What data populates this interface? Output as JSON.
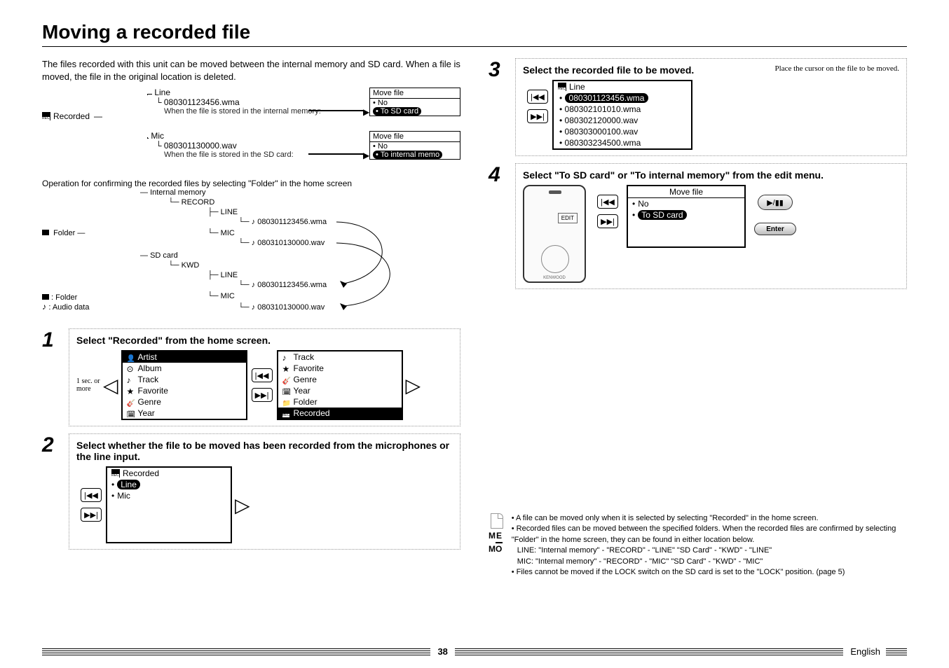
{
  "title": "Moving a recorded file",
  "intro": "The files recorded with this unit can be moved between the internal memory and SD card. When a file is moved, the file in the original location is deleted.",
  "recorded_label": "Recorded",
  "line_label": "Line",
  "mic_label": "Mic",
  "file1": "080301123456.wma",
  "file2": "080301130000.wav",
  "stored_internal": "When the file is stored in the internal memory:",
  "stored_sd": "When the file is stored in the SD card:",
  "movefile_title": "Move file",
  "no_label": "No",
  "to_sd": "To SD card",
  "to_internal": "To internal memo",
  "operation_text": "Operation for confirming the recorded files by selecting \"Folder\" in the home screen",
  "tree": {
    "folder": "Folder",
    "internal": "Internal memory",
    "sdcard": "SD card",
    "record": "RECORD",
    "kwd": "KWD",
    "line": "LINE",
    "mic": "MIC",
    "f_wma": "080301123456.wma",
    "f_wav": "080310130000.wav"
  },
  "legend_folder": ": Folder",
  "legend_audio": ": Audio data",
  "step1": {
    "title": "Select \"Recorded\" from the home screen.",
    "left": [
      "Artist",
      "Album",
      "Track",
      "Favorite",
      "Genre",
      "Year"
    ],
    "right": [
      "Track",
      "Favorite",
      "Genre",
      "Year",
      "Folder",
      "Recorded"
    ],
    "hold": "1 sec. or more"
  },
  "step2": {
    "title": "Select whether the file to be moved has been recorded from the microphones or the line input.",
    "header": "Recorded",
    "opts": [
      "Line",
      "Mic"
    ]
  },
  "step3": {
    "title": "Select the recorded file to be moved.",
    "hint": "Place the cursor on the file to be moved.",
    "header": "Line",
    "files": [
      "080301123456.wma",
      "080302101010.wma",
      "080302120000.wav",
      "080303000100.wav",
      "080303234500.wma"
    ]
  },
  "step4": {
    "title": "Select \"To SD card\" or \"To internal memory\" from the edit menu.",
    "menu_title": "Move file",
    "opts": [
      "No",
      "To SD card"
    ],
    "edit": "EDIT",
    "enter": "Enter"
  },
  "memo": {
    "label": "MEMO",
    "b1": "• A file can be moved only when it is selected by selecting \"Recorded\" in the home screen.",
    "b2": "• Recorded files can be moved between the specified folders. When the recorded files are confirmed by selecting \"Folder\" in the home screen, they can be found in either location below.",
    "b3": "LINE: \"Internal memory\" - \"RECORD\" - \"LINE\"       \"SD Card\" - \"KWD\" - \"LINE\"",
    "b4": "MIC: \"Internal memory\" - \"RECORD\" - \"MIC\"        \"SD Card\" - \"KWD\" - \"MIC\"",
    "b5": "• Files cannot be moved if the LOCK switch on the SD card is set to the \"LOCK\" position.  (page 5)"
  },
  "page_number": "38",
  "language": "English",
  "remote_brand": "KENWOOD"
}
